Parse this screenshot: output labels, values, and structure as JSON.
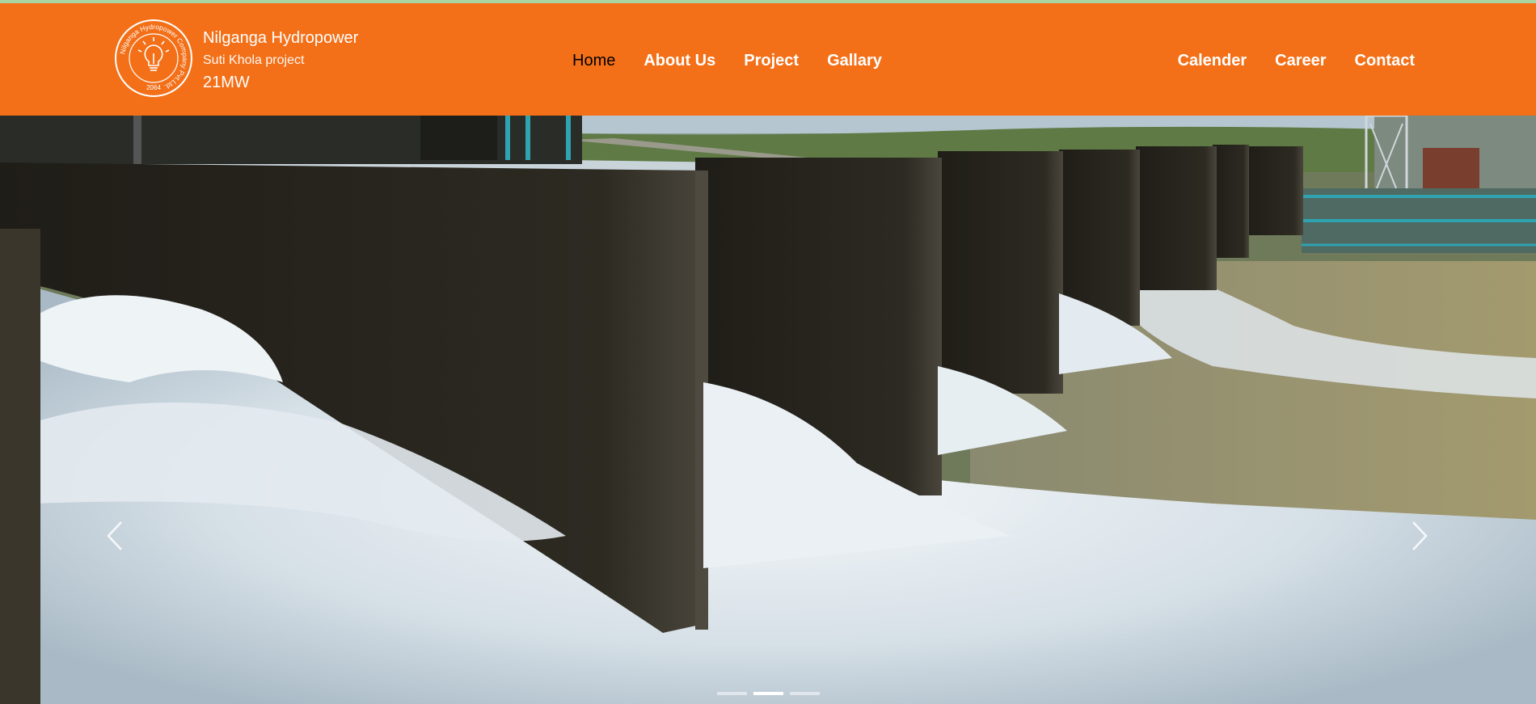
{
  "brand": {
    "name": "Nilganga Hydropower",
    "subtitle": "Suti Khola project",
    "capacity": "21MW",
    "logo_ring_text": "Nilganga Hydropower Company Pvt.Ltd.",
    "logo_year": "2064",
    "logo_icon": "lightbulb-icon"
  },
  "colors": {
    "navbar": "#f37018",
    "top_strip": "#a9d4a0",
    "active_link": "#000000",
    "link": "#ffffff"
  },
  "nav": {
    "main": [
      {
        "label": "Home",
        "active": true
      },
      {
        "label": "About Us",
        "active": false
      },
      {
        "label": "Project",
        "active": false
      },
      {
        "label": "Gallary",
        "active": false
      }
    ],
    "right": [
      {
        "label": "Calender"
      },
      {
        "label": "Career"
      },
      {
        "label": "Contact"
      }
    ]
  },
  "carousel": {
    "prev_icon": "chevron-left-icon",
    "next_icon": "chevron-right-icon",
    "slide_count": 3,
    "active_index": 1
  }
}
